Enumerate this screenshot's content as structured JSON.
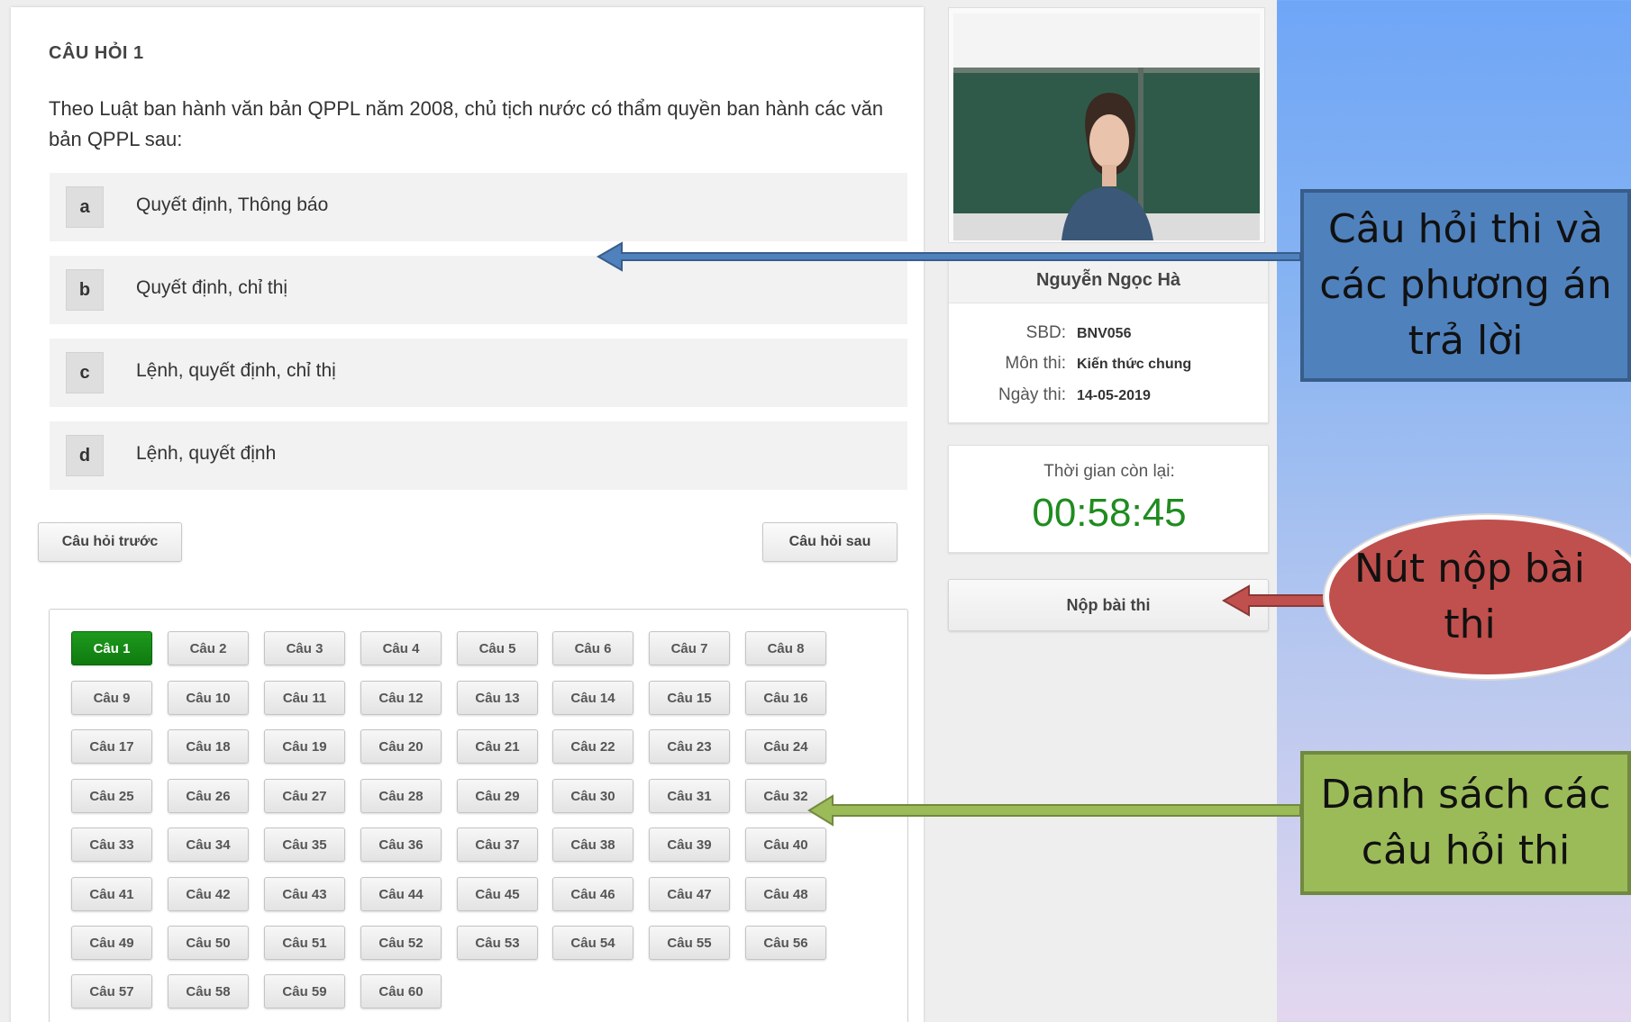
{
  "question": {
    "heading": "CÂU HỎI 1",
    "text": "Theo Luật ban hành văn bản QPPL năm 2008, chủ tịch nước có thẩm quyền ban hành các văn bản QPPL sau:",
    "options": [
      {
        "key": "a",
        "text": "Quyết định, Thông báo"
      },
      {
        "key": "b",
        "text": "Quyết định, chỉ thị"
      },
      {
        "key": "c",
        "text": "Lệnh, quyết định, chỉ thị"
      },
      {
        "key": "d",
        "text": "Lệnh, quyết định"
      }
    ]
  },
  "nav": {
    "prev": "Câu hỏi trước",
    "next": "Câu hỏi sau"
  },
  "question_list": {
    "active": "Câu 1",
    "items": [
      "Câu 1",
      "Câu 2",
      "Câu 3",
      "Câu 4",
      "Câu 5",
      "Câu 6",
      "Câu 7",
      "Câu 8",
      "Câu 9",
      "Câu 10",
      "Câu 11",
      "Câu 12",
      "Câu 13",
      "Câu 14",
      "Câu 15",
      "Câu 16",
      "Câu 17",
      "Câu 18",
      "Câu 19",
      "Câu 20",
      "Câu 21",
      "Câu 22",
      "Câu 23",
      "Câu 24",
      "Câu 25",
      "Câu 26",
      "Câu 27",
      "Câu 28",
      "Câu 29",
      "Câu 30",
      "Câu 31",
      "Câu 32",
      "Câu 33",
      "Câu 34",
      "Câu 35",
      "Câu 36",
      "Câu 37",
      "Câu 38",
      "Câu 39",
      "Câu 40",
      "Câu 41",
      "Câu 42",
      "Câu 43",
      "Câu 44",
      "Câu 45",
      "Câu 46",
      "Câu 47",
      "Câu 48",
      "Câu 49",
      "Câu 50",
      "Câu 51",
      "Câu 52",
      "Câu 53",
      "Câu 54",
      "Câu 55",
      "Câu 56",
      "Câu 57",
      "Câu 58",
      "Câu 59",
      "Câu 60"
    ]
  },
  "candidate": {
    "name": "Nguyễn Ngọc Hà",
    "sbd_label": "SBD:",
    "sbd": "BNV056",
    "subject_label": "Môn thi:",
    "subject": "Kiến thức chung",
    "date_label": "Ngày thi:",
    "date": "14-05-2019"
  },
  "timer": {
    "label": "Thời gian còn lại:",
    "value": "00:58:45"
  },
  "submit": {
    "label": "Nộp bài thi"
  },
  "callouts": {
    "questions": "Câu hỏi thi và các phương án trả lời",
    "submit": "Nút nộp bài thi",
    "list": "Danh sách các câu hỏi thi"
  },
  "colors": {
    "active_green": "#0f7a0f",
    "timer_green": "#1f8c1f",
    "callout_blue": "#4f81bd",
    "callout_red": "#c0504d",
    "callout_green": "#9bbb59"
  }
}
